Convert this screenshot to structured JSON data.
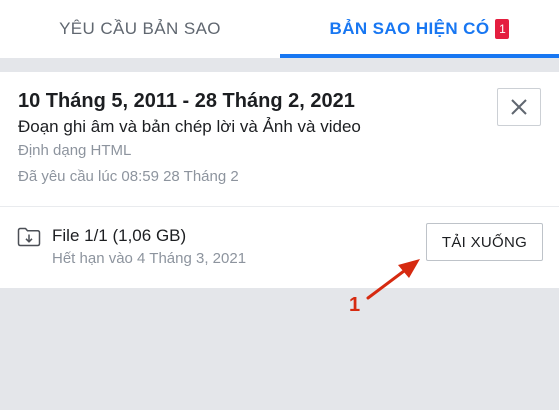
{
  "tabs": {
    "requests_label": "YÊU CẦU BẢN SAO",
    "available_label": "BẢN SAO HIỆN CÓ",
    "available_badge": "1"
  },
  "card": {
    "date_range": "10 Tháng 5, 2011 - 28 Tháng 2, 2021",
    "content_types": "Đoạn ghi âm và bản chép lời và Ảnh và video",
    "format": "Định dạng HTML",
    "requested_at": "Đã yêu cầu lúc 08:59 28 Tháng 2",
    "close_icon": "close-icon"
  },
  "file": {
    "icon": "folder-download-icon",
    "name": "File 1/1 (1,06 GB)",
    "expires": "Hết hạn vào 4 Tháng 3, 2021",
    "download_label": "TẢI XUỐNG"
  },
  "annotation": {
    "number": "1",
    "color": "#d62a10"
  },
  "colors": {
    "accent": "#1877f2",
    "badge": "#e41e3f",
    "background": "#e4e6ea"
  }
}
